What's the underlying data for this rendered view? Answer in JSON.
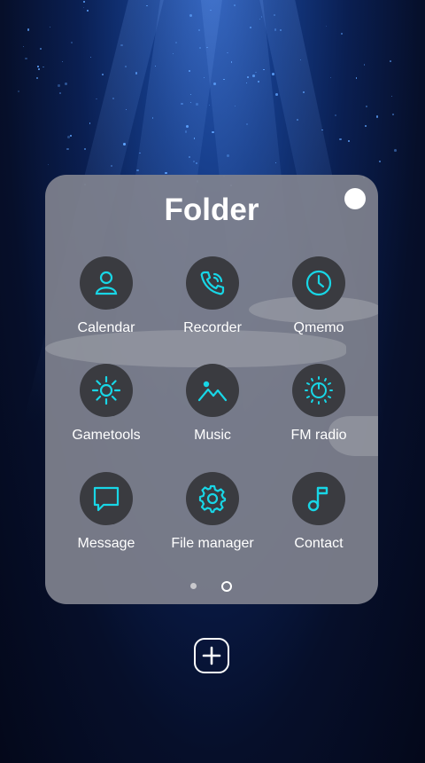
{
  "folder": {
    "title": "Folder"
  },
  "apps": [
    {
      "label": "Calendar",
      "icon": "person-icon"
    },
    {
      "label": "Recorder",
      "icon": "phone-icon"
    },
    {
      "label": "Qmemo",
      "icon": "clock-icon"
    },
    {
      "label": "Gametools",
      "icon": "sun-icon"
    },
    {
      "label": "Music",
      "icon": "image-icon"
    },
    {
      "label": "FM radio",
      "icon": "dial-icon"
    },
    {
      "label": "Message",
      "icon": "message-icon"
    },
    {
      "label": "File manager",
      "icon": "gear-icon"
    },
    {
      "label": "Contact",
      "icon": "music-note-icon"
    }
  ],
  "pager": {
    "page_count": 2,
    "current_page": 2
  },
  "colors": {
    "accent": "#18d6e6",
    "icon_background": "#3a3b40",
    "folder_background": "#80828e",
    "text": "#ffffff"
  }
}
